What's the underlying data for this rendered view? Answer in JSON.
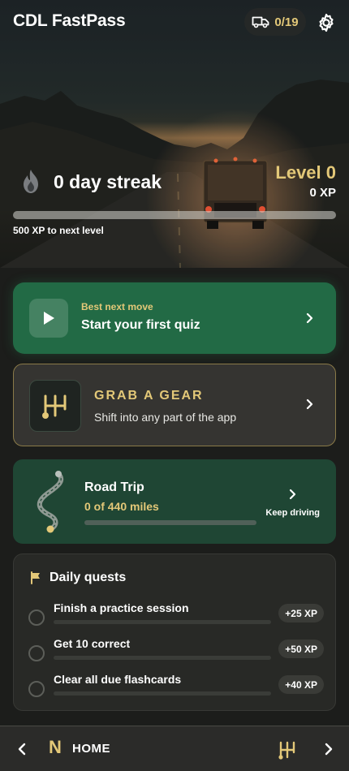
{
  "header": {
    "app_title": "CDL FastPass",
    "truck_count": "0/19",
    "truck_icon": "truck-icon",
    "settings_icon": "gear-icon"
  },
  "hero": {
    "streak_icon": "flame-icon",
    "streak_text": "0 day streak",
    "level": "Level 0",
    "xp": "0 XP",
    "xp_progress_fraction": 0,
    "next_level_text": "500 XP to next level"
  },
  "best_move": {
    "icon": "play-icon",
    "eyebrow": "Best next move",
    "title": "Start your first quiz"
  },
  "grab_gear": {
    "icon": "gear-shifter-icon",
    "title": "GRAB A GEAR",
    "subtitle": "Shift into any part of the app"
  },
  "road_trip": {
    "icon": "winding-road-icon",
    "title": "Road Trip",
    "miles": "0 of 440 miles",
    "progress_fraction": 0,
    "action": "Keep driving"
  },
  "daily_quests": {
    "icon": "flag-icon",
    "title": "Daily quests",
    "items": [
      {
        "label": "Finish a practice session",
        "xp": "+25 XP",
        "progress_fraction": 0
      },
      {
        "label": "Get 10 correct",
        "xp": "+50 XP",
        "progress_fraction": 0
      },
      {
        "label": "Clear all due flashcards",
        "xp": "+40 XP",
        "progress_fraction": 0
      }
    ]
  },
  "bottom_nav": {
    "gear_letter": "N",
    "label": "HOME"
  },
  "colors": {
    "accent_gold": "#e3c878",
    "primary_green": "#226a45",
    "road_green": "#1f4634",
    "background": "#1c1d1b"
  }
}
